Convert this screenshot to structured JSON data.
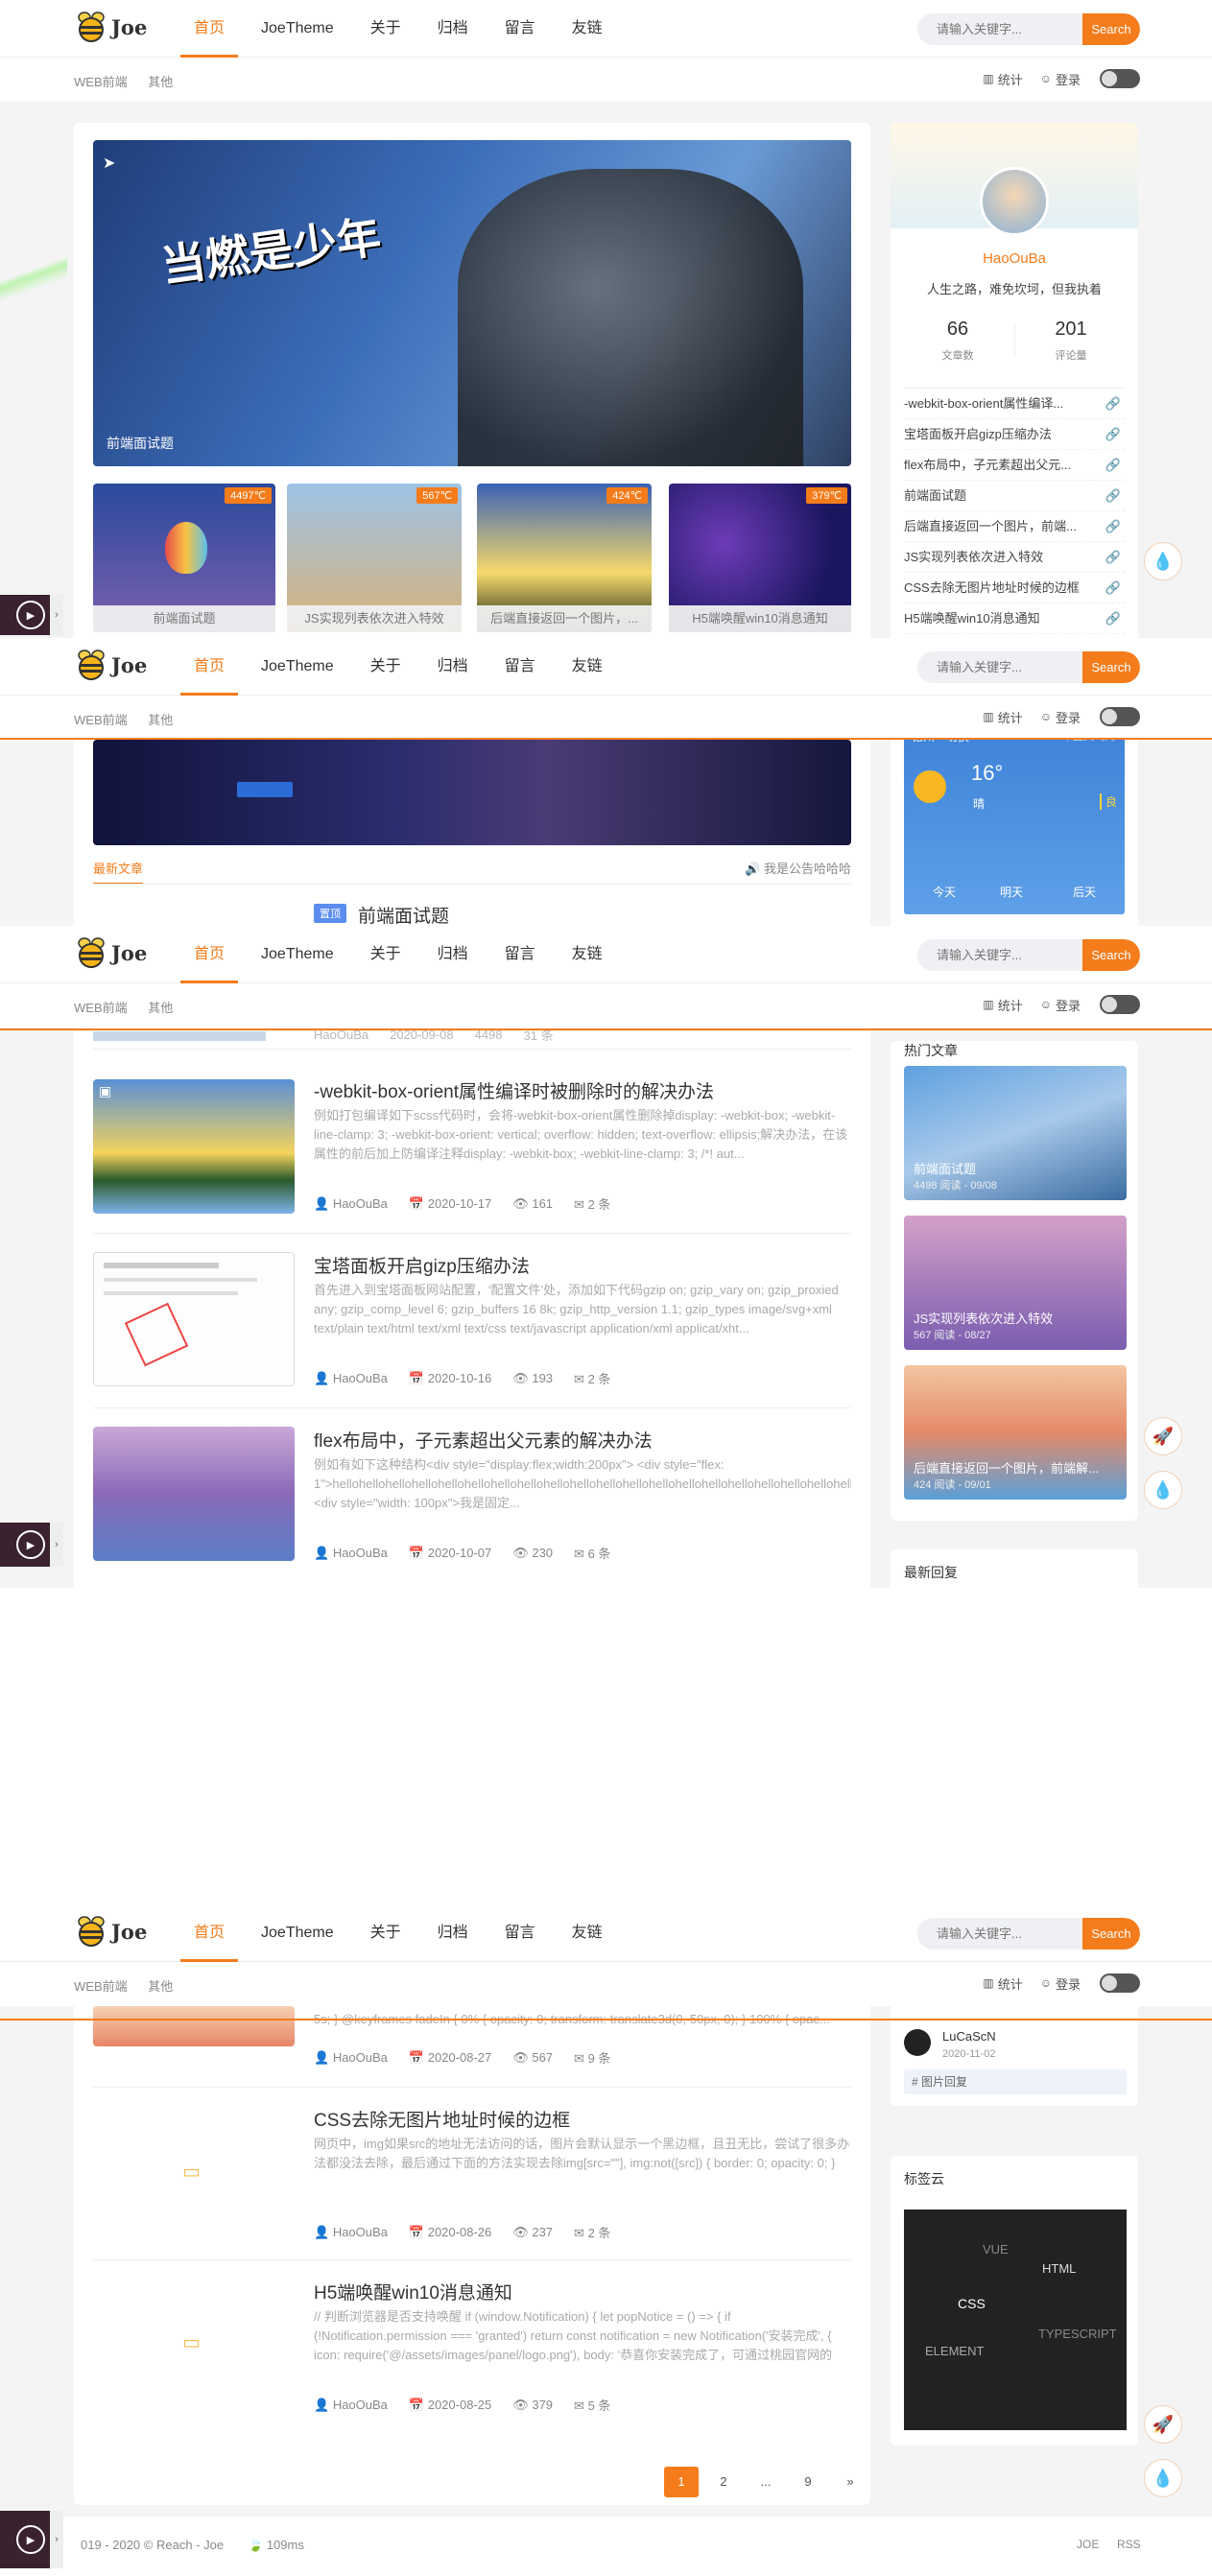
{
  "brand": {
    "logo_text": "Joe"
  },
  "nav": [
    "首页",
    "JoeTheme",
    "关于",
    "归档",
    "留言",
    "友链"
  ],
  "search": {
    "placeholder": "请输入关键字...",
    "button": "Search"
  },
  "subnav": {
    "cats": [
      "WEB前端",
      "其他"
    ],
    "stats": "统计",
    "login": "登录",
    "toggle": "黑"
  },
  "hero": {
    "caption": "前端面试题"
  },
  "thumbs": [
    {
      "tag": "4497℃",
      "caption": "前端面试题"
    },
    {
      "tag": "567℃",
      "caption": "JS实现列表依次进入特效"
    },
    {
      "tag": "424℃",
      "caption": "后端直接返回一个图片，..."
    },
    {
      "tag": "379℃",
      "caption": "H5端唤醒win10消息通知"
    }
  ],
  "profile": {
    "name": "HaoOuBa",
    "motto": "人生之路，难免坎坷，但我执着",
    "articles": "66",
    "articles_label": "文章数",
    "comments": "201",
    "comments_label": "评论量"
  },
  "side_links": [
    "-webkit-box-orient属性编译...",
    "宝塔面板开启gizp压缩办法",
    "flex布局中，子元素超出父元...",
    "前端面试题",
    "后端直接返回一个图片，前端...",
    "JS实现列表依次进入特效",
    "CSS去除无图片地址时候的边框",
    "H5端唤醒win10消息通知"
  ],
  "weather": {
    "city": "德州",
    "district": "切换",
    "source": "中国天气网",
    "temp": "16°",
    "cond": "晴",
    "aq": "良",
    "days": [
      "今天",
      "明天",
      "后天"
    ]
  },
  "latest": {
    "title": "最新文章",
    "notice": "我是公告哈哈哈"
  },
  "first_article": {
    "badge": "置顶",
    "title": "前端面试题"
  },
  "partial_meta": {
    "author": "HaoOuBa",
    "date": "2020-09-08",
    "views": "4498",
    "comments": "31 条"
  },
  "articles": [
    {
      "title": "-webkit-box-orient属性编译时被删除时的解决办法",
      "desc": "例如打包编译如下scss代码时，会将-webkit-box-orient属性删除掉display: -webkit-box; -webkit-line-clamp: 3; -webkit-box-orient: vertical; overflow: hidden; text-overflow: ellipsis;解决办法，在该属性的前后加上防编译注释display: -webkit-box; -webkit-line-clamp: 3; /*! aut...",
      "author": "HaoOuBa",
      "date": "2020-10-17",
      "views": "161",
      "comments": "2 条"
    },
    {
      "title": "宝塔面板开启gizp压缩办法",
      "desc": "首先进入到宝塔面板网站配置，'配置文件'处，添加如下代码gzip on; gzip_vary on; gzip_proxied any; gzip_comp_level 6; gzip_buffers 16 8k; gzip_http_version 1.1; gzip_types image/svg+xml text/plain text/html text/xml text/css text/javascript application/xml applicat/xht...",
      "author": "HaoOuBa",
      "date": "2020-10-16",
      "views": "193",
      "comments": "2 条"
    },
    {
      "title": "flex布局中，子元素超出父元素的解决办法",
      "desc": "例如有如下这种结构<div style=\"display:flex;width:200px\"> <div style=\"flex: 1\">hellohellohellohellohellohellohellohellohellohellohellohellohellohellohellohellohellohellohellohellohellohellohellohellohellohellohellohellohellohello</div> <div style=\"width: 100px\">我是固定...",
      "author": "HaoOuBa",
      "date": "2020-10-07",
      "views": "230",
      "comments": "6 条"
    }
  ],
  "hot": {
    "title": "热门文章",
    "items": [
      {
        "title": "前端面试题",
        "sub": "4498 阅读 - 09/08"
      },
      {
        "title": "JS实现列表依次进入特效",
        "sub": "567 阅读 - 08/27"
      },
      {
        "title": "后端直接返回一个图片，前端解...",
        "sub": "424 阅读 - 09/01"
      }
    ]
  },
  "recent_reply_title": "最新回复",
  "seg4_partial": {
    "desc": "5s; } @keyframes fadeIn { 0% { opacity: 0; transform: translate3d(0, 50px, 0); } 100% { opac...",
    "author": "HaoOuBa",
    "date": "2020-08-27",
    "views": "567",
    "comments": "9 条"
  },
  "articles2": [
    {
      "title": "CSS去除无图片地址时候的边框",
      "desc": "网页中，img如果src的地址无法访问的话，图片会默认显示一个黑边框，且丑无比，尝试了很多办法都没法去除，最后通过下面的方法实现去除img[src=\"\"], img:not([src]) { border: 0; opacity: 0; }",
      "author": "HaoOuBa",
      "date": "2020-08-26",
      "views": "237",
      "comments": "2 条"
    },
    {
      "title": "H5端唤醒win10消息通知",
      "desc": "// 判断浏览器是否支持唤醒 if (window.Notification) { let popNotice = () => { if (!Notification.permission === 'granted') return const notification = new Notification('安装完成', { icon: require('@/assets/images/panel/logo.png'), body: '恭喜你安装完成了，可通过桃园官网的 电...",
      "author": "HaoOuBa",
      "date": "2020-08-25",
      "views": "379",
      "comments": "5 条"
    }
  ],
  "reply": {
    "user": "LuCaScN",
    "date": "2020-11-02",
    "text": "# 图片回复"
  },
  "tags": {
    "title": "标签云",
    "items": [
      "VUE",
      "HTML",
      "CSS",
      "TYPESCRIPT",
      "ELEMENT"
    ]
  },
  "pager": [
    "1",
    "2",
    "...",
    "9",
    "»"
  ],
  "footer": {
    "copy": "019 - 2020 © Reach - Joe",
    "time": "109ms",
    "links": [
      "JOE",
      "RSS"
    ]
  },
  "colors": {
    "accent": "#f57c1b"
  }
}
